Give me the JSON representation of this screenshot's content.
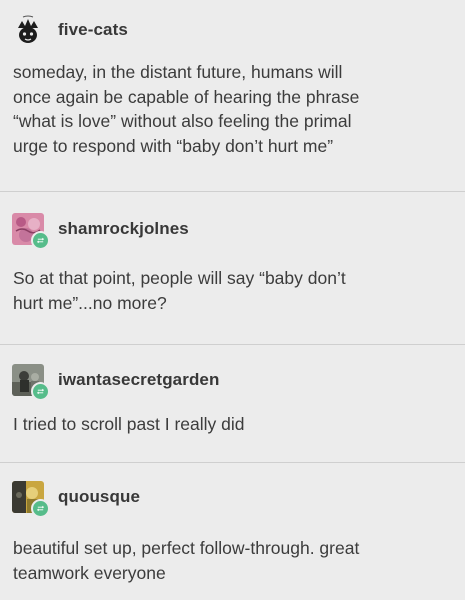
{
  "posts": [
    {
      "username": "five-cats",
      "text": "someday, in the distant future, humans will\nonce again be capable of hearing the phrase\n“what is love” without also feeling the primal\nurge to  respond with “baby don’t hurt me”",
      "avatar_icon": "crowned-face-avatar",
      "is_reblog": false
    },
    {
      "username": "shamrockjolnes",
      "text": "So at that point, people will say “baby don’t\nhurt me”...no more?",
      "avatar_icon": "pink-floral-avatar",
      "is_reblog": true
    },
    {
      "username": "iwantasecretgarden",
      "text": "I tried to scroll past I really did",
      "avatar_icon": "photo-avatar",
      "is_reblog": true
    },
    {
      "username": "quousque",
      "text": "beautiful set up, perfect follow-through. great\nteamwork everyone",
      "avatar_icon": "yellow-photo-avatar",
      "is_reblog": true
    }
  ],
  "colors": {
    "background": "#ececec",
    "reblog_badge": "#56bc8a",
    "divider": "#cfcfcf"
  }
}
